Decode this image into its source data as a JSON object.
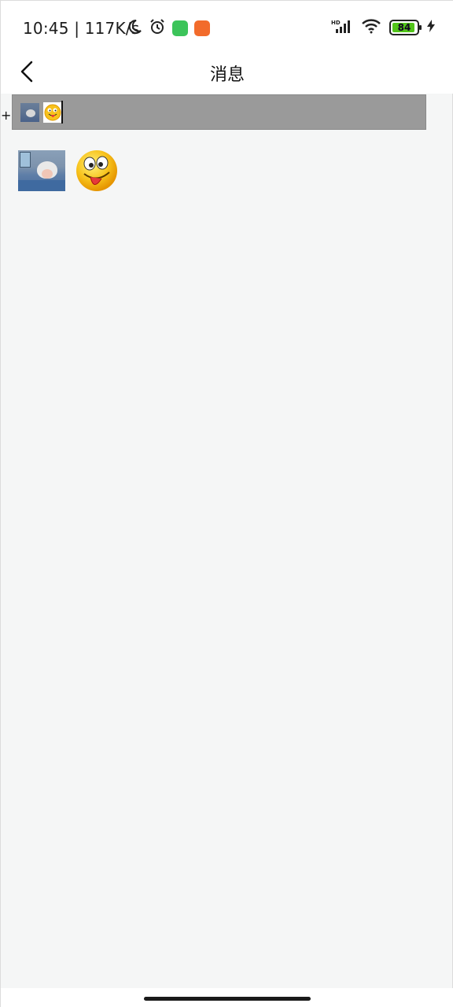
{
  "status_bar": {
    "time": "10:45",
    "net_speed": "| 117K/s",
    "battery": "84",
    "icons": [
      "moon-icon",
      "alarm-icon",
      "green-app-icon",
      "orange-video-app-icon",
      "hd-signal-icon",
      "wifi-icon",
      "battery-icon",
      "charging-icon"
    ]
  },
  "nav": {
    "title": "消息",
    "back_icon": "chevron-left-icon"
  },
  "composer": {
    "plus": "+",
    "attachments": [
      "photo-thumbnail",
      "emoji-thumbnail"
    ]
  },
  "messages": [
    {
      "type": "image",
      "image": "grandmother-photo"
    },
    {
      "type": "emoji",
      "image": "tongue-out-smiley-emoji"
    }
  ],
  "colors": {
    "background": "#f5f6f6",
    "composer_background": "#9a9a9a",
    "battery_fill": "#52c41a"
  }
}
